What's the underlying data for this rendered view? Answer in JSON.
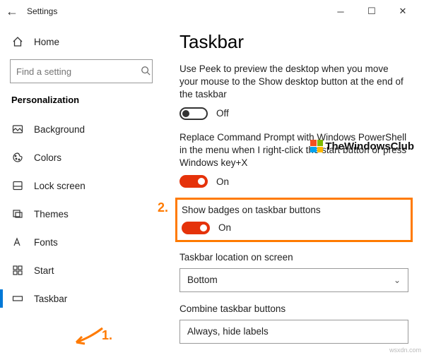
{
  "titlebar": {
    "title": "Settings"
  },
  "sidebar": {
    "home": "Home",
    "search_placeholder": "Find a setting",
    "category": "Personalization",
    "items": [
      {
        "label": "Background"
      },
      {
        "label": "Colors"
      },
      {
        "label": "Lock screen"
      },
      {
        "label": "Themes"
      },
      {
        "label": "Fonts"
      },
      {
        "label": "Start"
      },
      {
        "label": "Taskbar"
      }
    ]
  },
  "content": {
    "heading": "Taskbar",
    "peek_desc": "Use Peek to preview the desktop when you move your mouse to the Show desktop button at the end of the taskbar",
    "peek_state": "Off",
    "cmd_desc": "Replace Command Prompt with Windows PowerShell in the menu when I right-click the start button or press Windows key+X",
    "cmd_state": "On",
    "badges_desc": "Show badges on taskbar buttons",
    "badges_state": "On",
    "location_label": "Taskbar location on screen",
    "location_value": "Bottom",
    "combine_label": "Combine taskbar buttons",
    "combine_value": "Always, hide labels"
  },
  "annotations": {
    "one": "1.",
    "two": "2."
  },
  "watermark": "TheWindowsClub",
  "attribution": "wsxdn.com"
}
